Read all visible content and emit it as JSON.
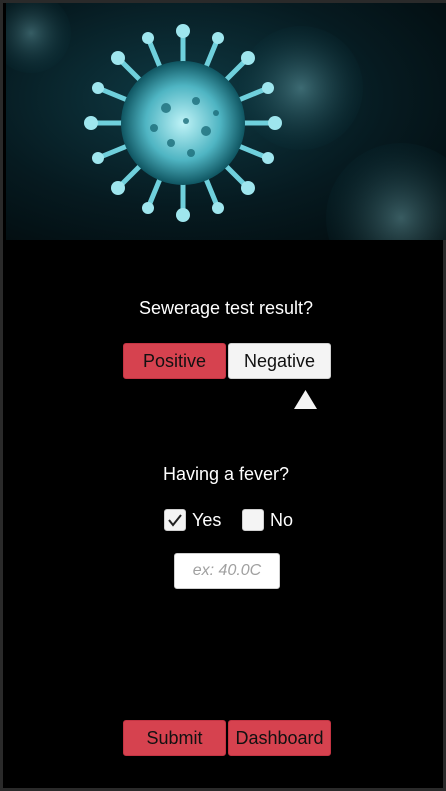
{
  "hero": {
    "image_description_icon": "coronavirus-image"
  },
  "sewerage": {
    "question": "Sewerage test result?",
    "positive_label": "Positive",
    "negative_label": "Negative",
    "selected": "Negative",
    "pointer_icon": "triangle-up-icon"
  },
  "fever": {
    "question": "Having a fever?",
    "yes_label": "Yes",
    "no_label": "No",
    "yes_checked": true,
    "no_checked": false,
    "temperature_value": "",
    "temperature_placeholder": "ex: 40.0C"
  },
  "actions": {
    "submit_label": "Submit",
    "dashboard_label": "Dashboard"
  },
  "colors": {
    "accent_red": "#d6424f",
    "background": "#000000",
    "button_light": "#f4f4f4"
  }
}
